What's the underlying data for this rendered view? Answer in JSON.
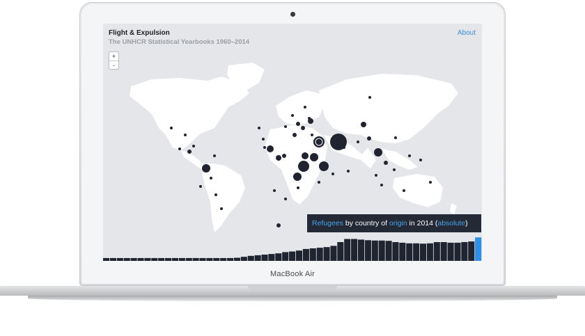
{
  "app": {
    "title": "Flight & Expulsion",
    "subtitle": "The UNHCR Statistical Yearbooks 1960–2014",
    "about_label": "About"
  },
  "zoom": {
    "in_label": "+",
    "out_label": "-"
  },
  "caption": {
    "metric_link": "Refugees",
    "text_1": " by country of ",
    "group_link": "origin",
    "text_2": " in 2014 (",
    "mode_link": "absolute",
    "text_3": ")"
  },
  "device": {
    "brand_label": "MacBook Air"
  },
  "colors": {
    "land": "#ffffff",
    "sea": "#e5e6e9",
    "bubble": "#1f2430",
    "accent": "#2e8ee8",
    "bars": "#1f2430"
  },
  "timeline": {
    "start_year": 1960,
    "end_year": 2014,
    "selected_year": 2014,
    "relative_values": [
      0.09,
      0.09,
      0.09,
      0.09,
      0.09,
      0.09,
      0.09,
      0.09,
      0.09,
      0.09,
      0.09,
      0.09,
      0.09,
      0.09,
      0.09,
      0.09,
      0.09,
      0.09,
      0.09,
      0.1,
      0.13,
      0.16,
      0.18,
      0.2,
      0.22,
      0.24,
      0.28,
      0.3,
      0.33,
      0.38,
      0.4,
      0.42,
      0.44,
      0.48,
      0.6,
      0.7,
      0.7,
      0.68,
      0.66,
      0.65,
      0.65,
      0.64,
      0.6,
      0.58,
      0.56,
      0.56,
      0.55,
      0.56,
      0.6,
      0.6,
      0.58,
      0.58,
      0.6,
      0.62,
      0.75
    ]
  }
}
